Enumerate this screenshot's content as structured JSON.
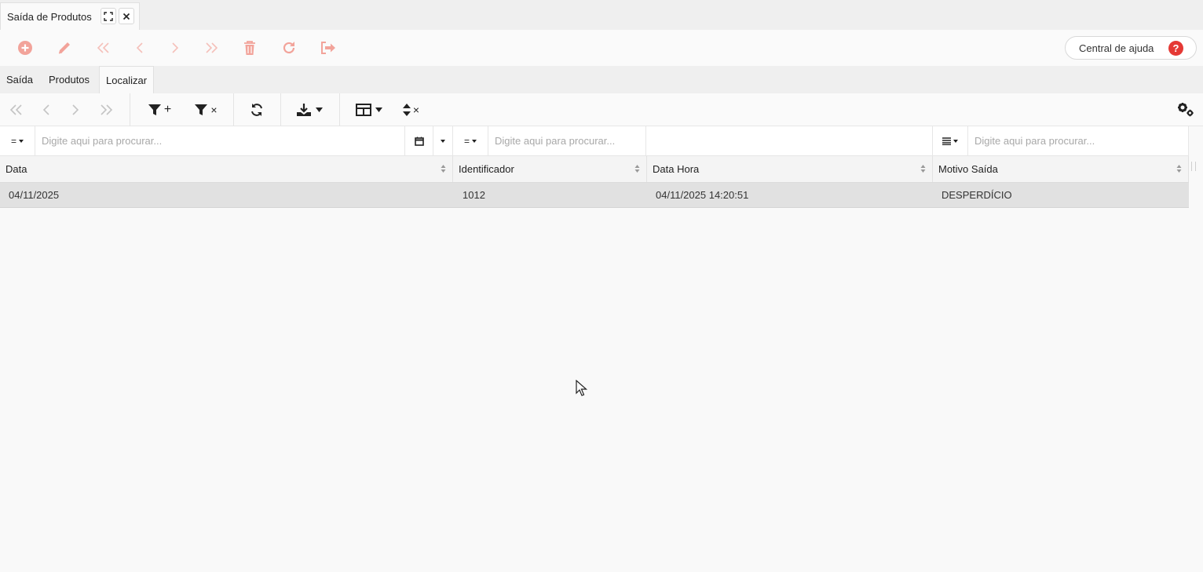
{
  "window_tab": {
    "title": "Saída de Produtos"
  },
  "actionbar": {
    "help_label": "Central de ajuda",
    "help_glyph": "?"
  },
  "subtabs": [
    "Saída",
    "Produtos",
    "Localizar"
  ],
  "gridbar": {
    "filter_add_glyph": "+",
    "filter_clear_glyph": "×",
    "sort_clear_glyph": "×"
  },
  "filters": {
    "data": {
      "operator": "=",
      "placeholder": "Digite aqui para procurar..."
    },
    "identificador": {
      "operator": "=",
      "placeholder": "Digite aqui para procurar..."
    },
    "motivo": {
      "placeholder": "Digite aqui para procurar..."
    }
  },
  "columns": [
    "Data",
    "Identificador",
    "Data Hora",
    "Motivo Saída"
  ],
  "rows": [
    [
      "04/11/2025",
      "1012",
      "04/11/2025 14:20:51",
      "DESPERDÍCIO"
    ]
  ],
  "colors": {
    "accent_disabled": "#f2a39a",
    "help_red": "#e53935",
    "selected_row": "#e1e1e1"
  }
}
